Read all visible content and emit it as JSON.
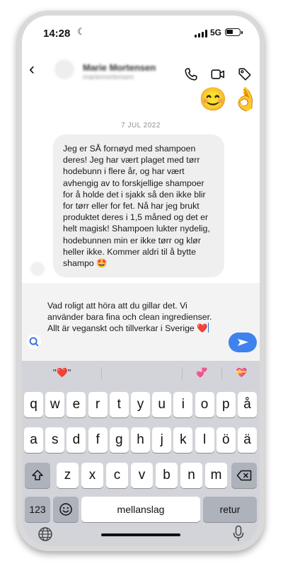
{
  "status_bar": {
    "time": "14:28",
    "network": "5G",
    "moon_icon": "moon-icon"
  },
  "header": {
    "contact_name": "Marie Mortensen",
    "contact_username": "mariemortensen",
    "icons": [
      "back-chevron-icon",
      "phone-icon",
      "video-icon",
      "tag-icon"
    ]
  },
  "chat": {
    "top_emojis": [
      "😊",
      "👌"
    ],
    "date_divider": "7 JUL 2022",
    "received_message": "Jeg er SÅ fornøyd med shampoen deres! Jeg har vært plaget med tørr hodebunn i flere år, og har vært avhengig av to forskjellige shampoer for å holde det i sjakk så den ikke blir for tørr eller for fet. Nå har jeg brukt produktet deres i 1,5 måned og det er helt magisk! Shampoen lukter nydelig, hodebunnen min er ikke tørr og klør heller ikke. Kommer aldri til å bytte shampo 🤩"
  },
  "compose": {
    "draft": "Vad roligt att höra att du gillar det. Vi använder bara fina och clean ingredienser. Allt är veganskt och tillverkar i Sverige ❤️",
    "send_label": ""
  },
  "keyboard": {
    "suggestions": [
      "\"❤️\"",
      "💞",
      "💝"
    ],
    "row1": [
      "q",
      "w",
      "e",
      "r",
      "t",
      "y",
      "u",
      "i",
      "o",
      "p",
      "å"
    ],
    "row2": [
      "a",
      "s",
      "d",
      "f",
      "g",
      "h",
      "j",
      "k",
      "l",
      "ö",
      "ä"
    ],
    "row3": [
      "z",
      "x",
      "c",
      "v",
      "b",
      "n",
      "m"
    ],
    "numbers_key": "123",
    "space_key": "mellanslag",
    "return_key": "retur",
    "accent_color": "#3e82ee"
  }
}
